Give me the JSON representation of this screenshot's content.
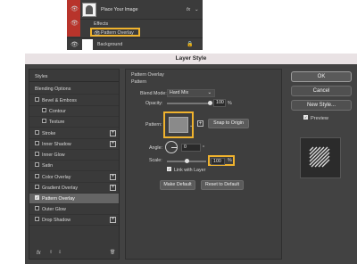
{
  "layers_panel": {
    "layer_name": "Place Your Image",
    "fx_badge": "fx",
    "effects_label": "Effects",
    "effect_item": "Pattern Overlay",
    "background_layer": "Background"
  },
  "dialog": {
    "title": "Layer Style",
    "styles_header": "Styles",
    "style_items": [
      {
        "label": "Blending Options"
      },
      {
        "label": "Bevel & Emboss"
      },
      {
        "label": "Contour"
      },
      {
        "label": "Texture"
      },
      {
        "label": "Stroke"
      },
      {
        "label": "Inner Shadow"
      },
      {
        "label": "Inner Glow"
      },
      {
        "label": "Satin"
      },
      {
        "label": "Color Overlay"
      },
      {
        "label": "Gradient Overlay"
      },
      {
        "label": "Pattern Overlay"
      },
      {
        "label": "Outer Glow"
      },
      {
        "label": "Drop Shadow"
      }
    ],
    "fx_label": "fx"
  },
  "pattern_overlay": {
    "section_title": "Pattern Overlay",
    "group_title": "Pattern",
    "blend_mode_label": "Blend Mode:",
    "blend_mode_value": "Hard Mix",
    "opacity_label": "Opacity:",
    "opacity_value": "100",
    "percent": "%",
    "pattern_label": "Pattern:",
    "snap_to_origin": "Snap to Origin",
    "angle_label": "Angle:",
    "angle_value": "0",
    "degree_sign": "°",
    "scale_label": "Scale:",
    "scale_value": "100",
    "link_with_layer": "Link with Layer",
    "make_default": "Make Default",
    "reset_to_default": "Reset to Default"
  },
  "buttons": {
    "ok": "OK",
    "cancel": "Cancel",
    "new_style": "New Style...",
    "preview": "Preview"
  },
  "colors": {
    "highlight": "#f0b32e",
    "dialog_bg": "#424242",
    "selected_row": "#656565"
  }
}
